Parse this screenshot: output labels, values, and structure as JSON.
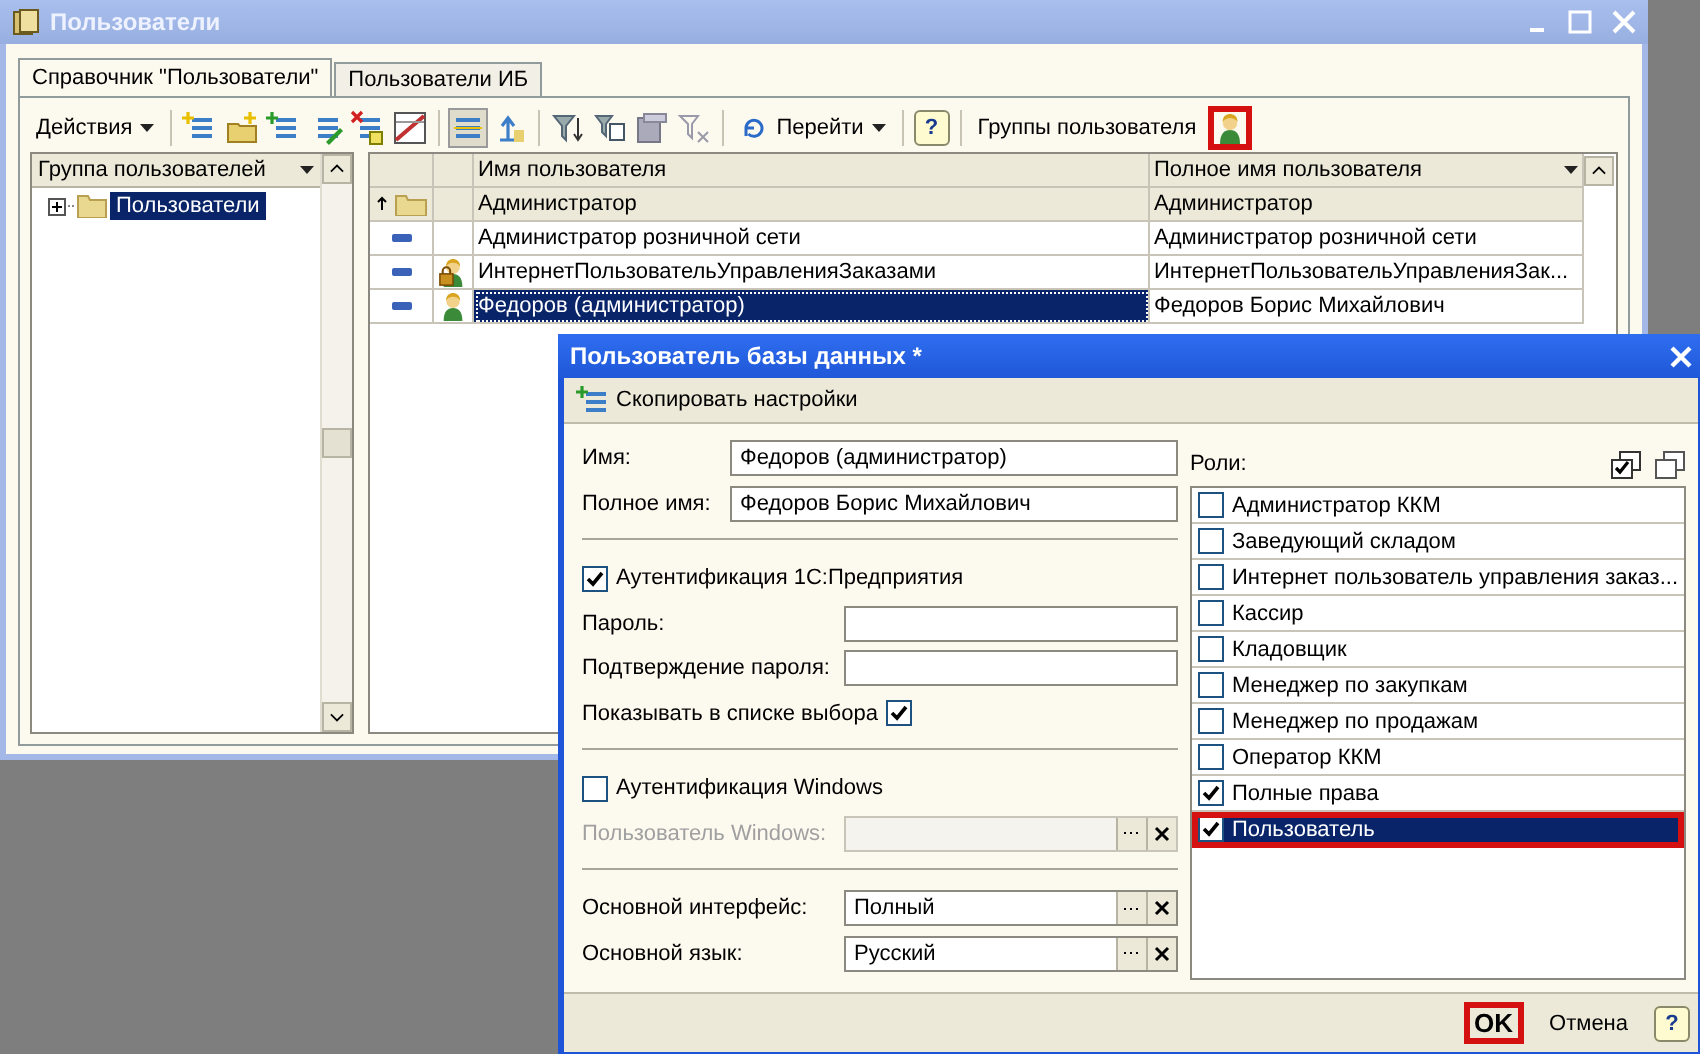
{
  "main_window": {
    "title": "Пользователи"
  },
  "tabs": [
    {
      "label": "Справочник \"Пользователи\"",
      "selected": true
    },
    {
      "label": "Пользователи ИБ",
      "selected": false
    }
  ],
  "toolbar": {
    "actions_menu": "Действия",
    "goto_menu": "Перейти",
    "help": "?",
    "groups_label": "Группы пользователя",
    "groups_button_highlighted": true
  },
  "group_tree": {
    "header": "Группа пользователей",
    "items": [
      {
        "label": "Пользователи",
        "selected": true,
        "expanded": false
      }
    ]
  },
  "users_table": {
    "columns": [
      "Имя пользователя",
      "Полное имя пользователя"
    ],
    "rows": [
      {
        "kind": "group",
        "name": "Администратор",
        "full_name": "Администратор",
        "selected": false
      },
      {
        "kind": "plain",
        "name": "Администратор розничной сети",
        "full_name": "Администратор розничной сети",
        "selected": false
      },
      {
        "kind": "locked_user",
        "name": "ИнтернетПользовательУправленияЗаказами",
        "full_name": "ИнтернетПользовательУправленияЗак...",
        "selected": false
      },
      {
        "kind": "user",
        "name": "Федоров (администратор)",
        "full_name": "Федоров Борис Михайлович",
        "selected": true
      }
    ]
  },
  "dialog": {
    "title": "Пользователь базы данных *",
    "copy_button": "Скопировать настройки",
    "name": {
      "label": "Имя:",
      "value": "Федоров (администратор)"
    },
    "full_name": {
      "label": "Полное имя:",
      "value": "Федоров Борис Михайлович"
    },
    "auth_1c": {
      "label": "Аутентификация 1С:Предприятия",
      "checked": true
    },
    "password": {
      "label": "Пароль:"
    },
    "password_confirm": {
      "label": "Подтверждение пароля:"
    },
    "show_in_list": {
      "label": "Показывать в списке выбора",
      "checked": true
    },
    "auth_windows": {
      "label": "Аутентификация Windows",
      "checked": false
    },
    "windows_user": {
      "label": "Пользователь Windows:",
      "disabled": true
    },
    "interface": {
      "label": "Основной интерфейс:",
      "value": "Полный"
    },
    "language": {
      "label": "Основной язык:",
      "value": "Русский"
    },
    "roles": {
      "label": "Роли:",
      "items": [
        {
          "label": "Администратор ККМ",
          "checked": false,
          "selected": false,
          "highlighted": false
        },
        {
          "label": "Заведующий складом",
          "checked": false,
          "selected": false,
          "highlighted": false
        },
        {
          "label": "Интернет пользователь управления заказ...",
          "checked": false,
          "selected": false,
          "highlighted": false
        },
        {
          "label": "Кассир",
          "checked": false,
          "selected": false,
          "highlighted": false
        },
        {
          "label": "Кладовщик",
          "checked": false,
          "selected": false,
          "highlighted": false
        },
        {
          "label": "Менеджер по закупкам",
          "checked": false,
          "selected": false,
          "highlighted": false
        },
        {
          "label": "Менеджер по продажам",
          "checked": false,
          "selected": false,
          "highlighted": false
        },
        {
          "label": "Оператор ККМ",
          "checked": false,
          "selected": false,
          "highlighted": false
        },
        {
          "label": "Полные права",
          "checked": true,
          "selected": false,
          "highlighted": false
        },
        {
          "label": "Пользователь",
          "checked": true,
          "selected": true,
          "highlighted": true
        }
      ]
    },
    "buttons": {
      "ok": "OK",
      "ok_highlighted": true,
      "cancel": "Отмена",
      "help": "?"
    }
  }
}
